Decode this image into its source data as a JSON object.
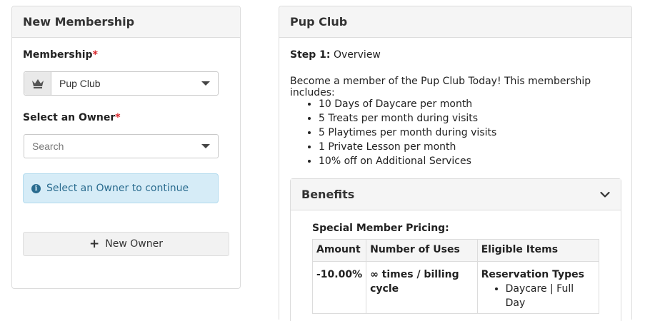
{
  "new_membership": {
    "title": "New Membership",
    "membership_label": "Membership",
    "required_mark": "*",
    "membership_value": "Pup Club",
    "owner_label": "Select an Owner",
    "owner_placeholder": "Search",
    "alert_text": "Select an Owner to continue",
    "new_owner_button": "New Owner",
    "icons": {
      "membership_addon": "crown-icon",
      "alert": "info-icon",
      "button": "plus-icon"
    }
  },
  "pup_club": {
    "title": "Pup Club",
    "step_prefix": "Step 1:",
    "step_name": "Overview",
    "intro": "Become a member of the Pup Club Today! This membership includes:",
    "includes": [
      "10 Days of Daycare per month",
      "5 Treats per month during visits",
      "5 Playtimes per month during visits",
      "1 Private Lesson per month",
      "10% off on Additional Services"
    ],
    "benefits": {
      "title": "Benefits",
      "special_pricing_label": "Special Member Pricing:",
      "columns": [
        "Amount",
        "Number of Uses",
        "Eligible Items"
      ],
      "rows": [
        {
          "amount": "-10.00%",
          "uses": "∞ times / billing cycle",
          "eligible_heading": "Reservation Types",
          "eligible_items": [
            "Daycare | Full Day"
          ]
        }
      ]
    }
  },
  "colors": {
    "required": "#d9262b",
    "alert_bg": "#d6ecf7",
    "alert_text": "#2a6c8f"
  }
}
